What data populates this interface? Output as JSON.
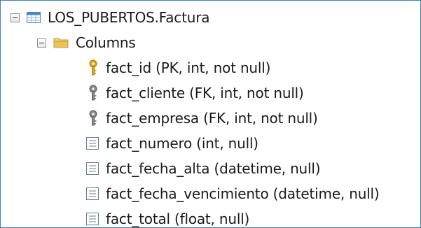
{
  "tree": {
    "table": {
      "label": "LOS_PUBERTOS.Factura",
      "icon": "table-icon",
      "expanded": true
    },
    "columns_folder": {
      "label": "Columns",
      "icon": "folder-icon",
      "expanded": true
    },
    "columns": [
      {
        "label": "fact_id (PK, int, not null)",
        "icon": "primary-key-icon"
      },
      {
        "label": "fact_cliente (FK, int, not null)",
        "icon": "foreign-key-icon"
      },
      {
        "label": "fact_empresa (FK, int, not null)",
        "icon": "foreign-key-icon"
      },
      {
        "label": "fact_numero (int, null)",
        "icon": "column-icon"
      },
      {
        "label": "fact_fecha_alta (datetime, null)",
        "icon": "column-icon"
      },
      {
        "label": "fact_fecha_vencimiento (datetime, null)",
        "icon": "column-icon"
      },
      {
        "label": "fact_total (float, null)",
        "icon": "column-icon"
      }
    ]
  },
  "colors": {
    "border": "#3c7fb1",
    "key_gold": "#e0a81c",
    "key_gray": "#8a8a8a",
    "folder": "#e8c15a",
    "table_blue": "#4f81bd"
  }
}
